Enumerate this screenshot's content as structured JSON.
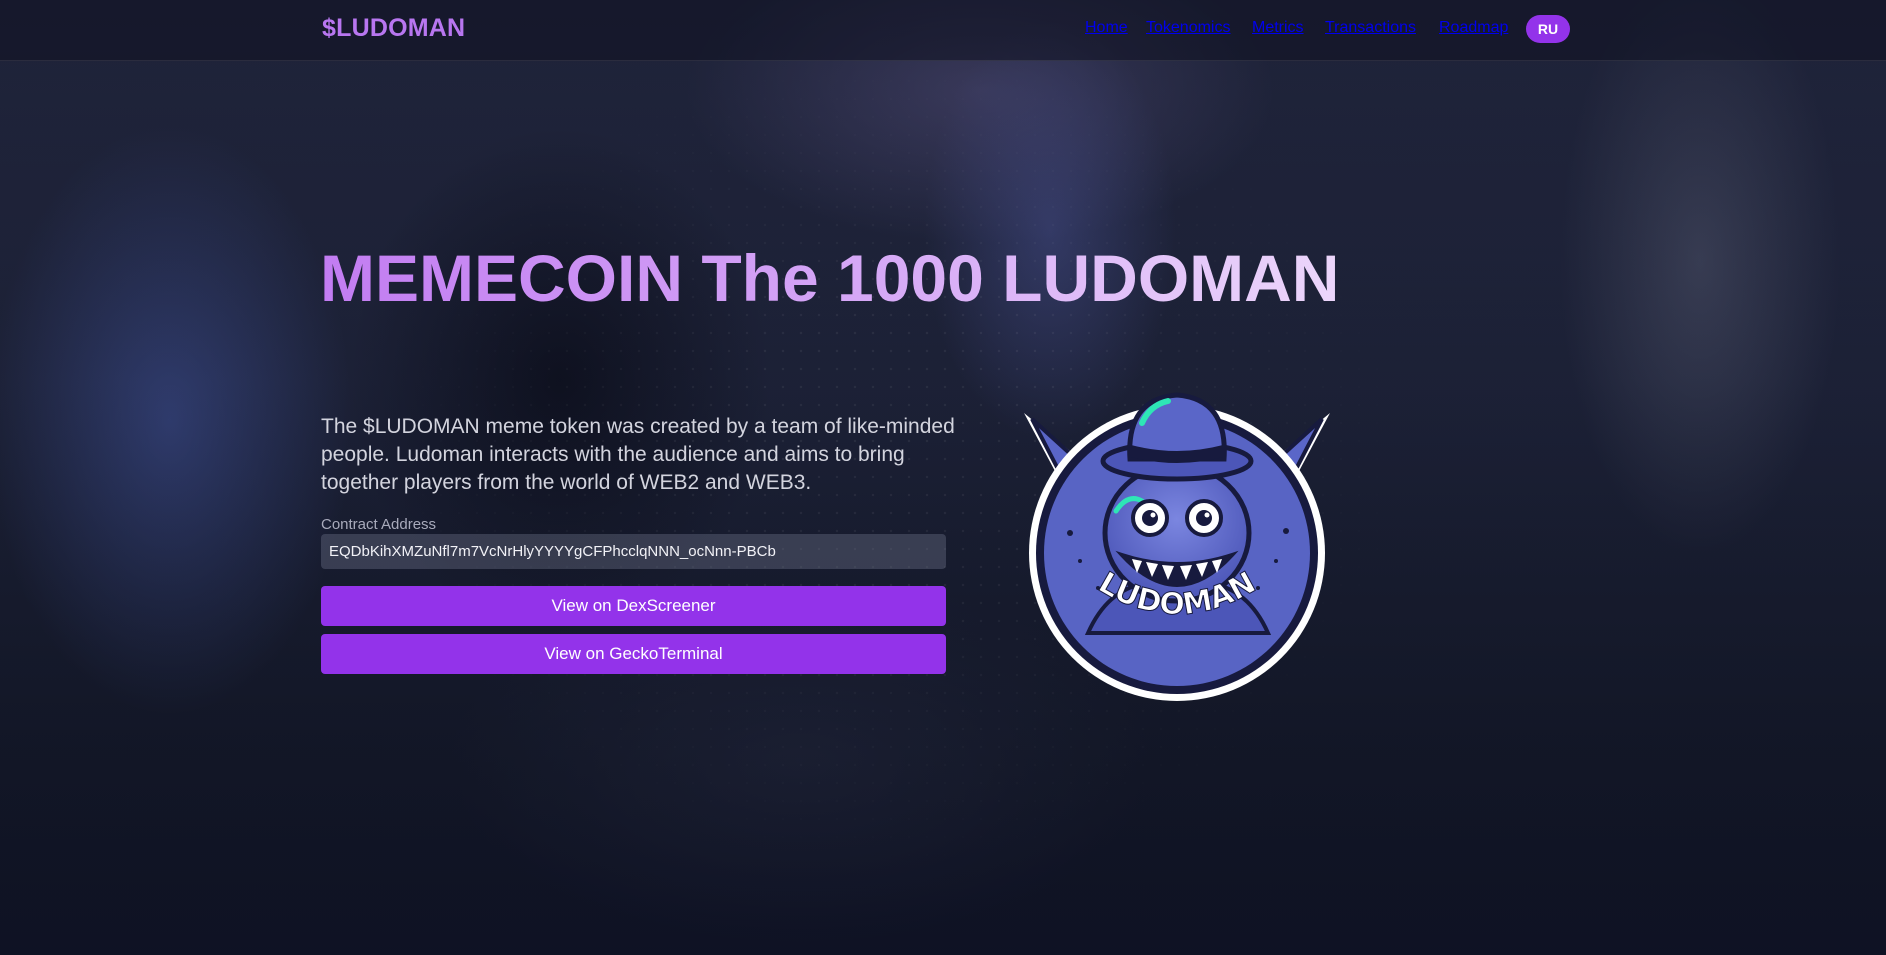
{
  "nav": {
    "brand": "$LUDOMAN",
    "links": [
      "Home",
      "Tokenomics",
      "Metrics",
      "Transactions",
      "Roadmap"
    ],
    "lang_button": "RU"
  },
  "hero": {
    "title": "MEMECOIN The 1000 LUDOMAN",
    "description": "The $LUDOMAN meme token was created by a team of like-minded people. Ludoman interacts with the audience and aims to bring together players from the world of WEB2 and WEB3.",
    "contract_label": "Contract Address",
    "contract_address": "EQDbKihXMZuNfl7m7VcNrHlyYYYYgCFPhcclqNNN_ocNnn-PBCb",
    "buttons": {
      "dexscreener": "View on DexScreener",
      "geckoterminal": "View on GeckoTerminal"
    },
    "logo_text": "LUDOMAN"
  },
  "colors": {
    "accent": "#9333ea",
    "brand": "#b876f0",
    "background": "#161a2c"
  }
}
